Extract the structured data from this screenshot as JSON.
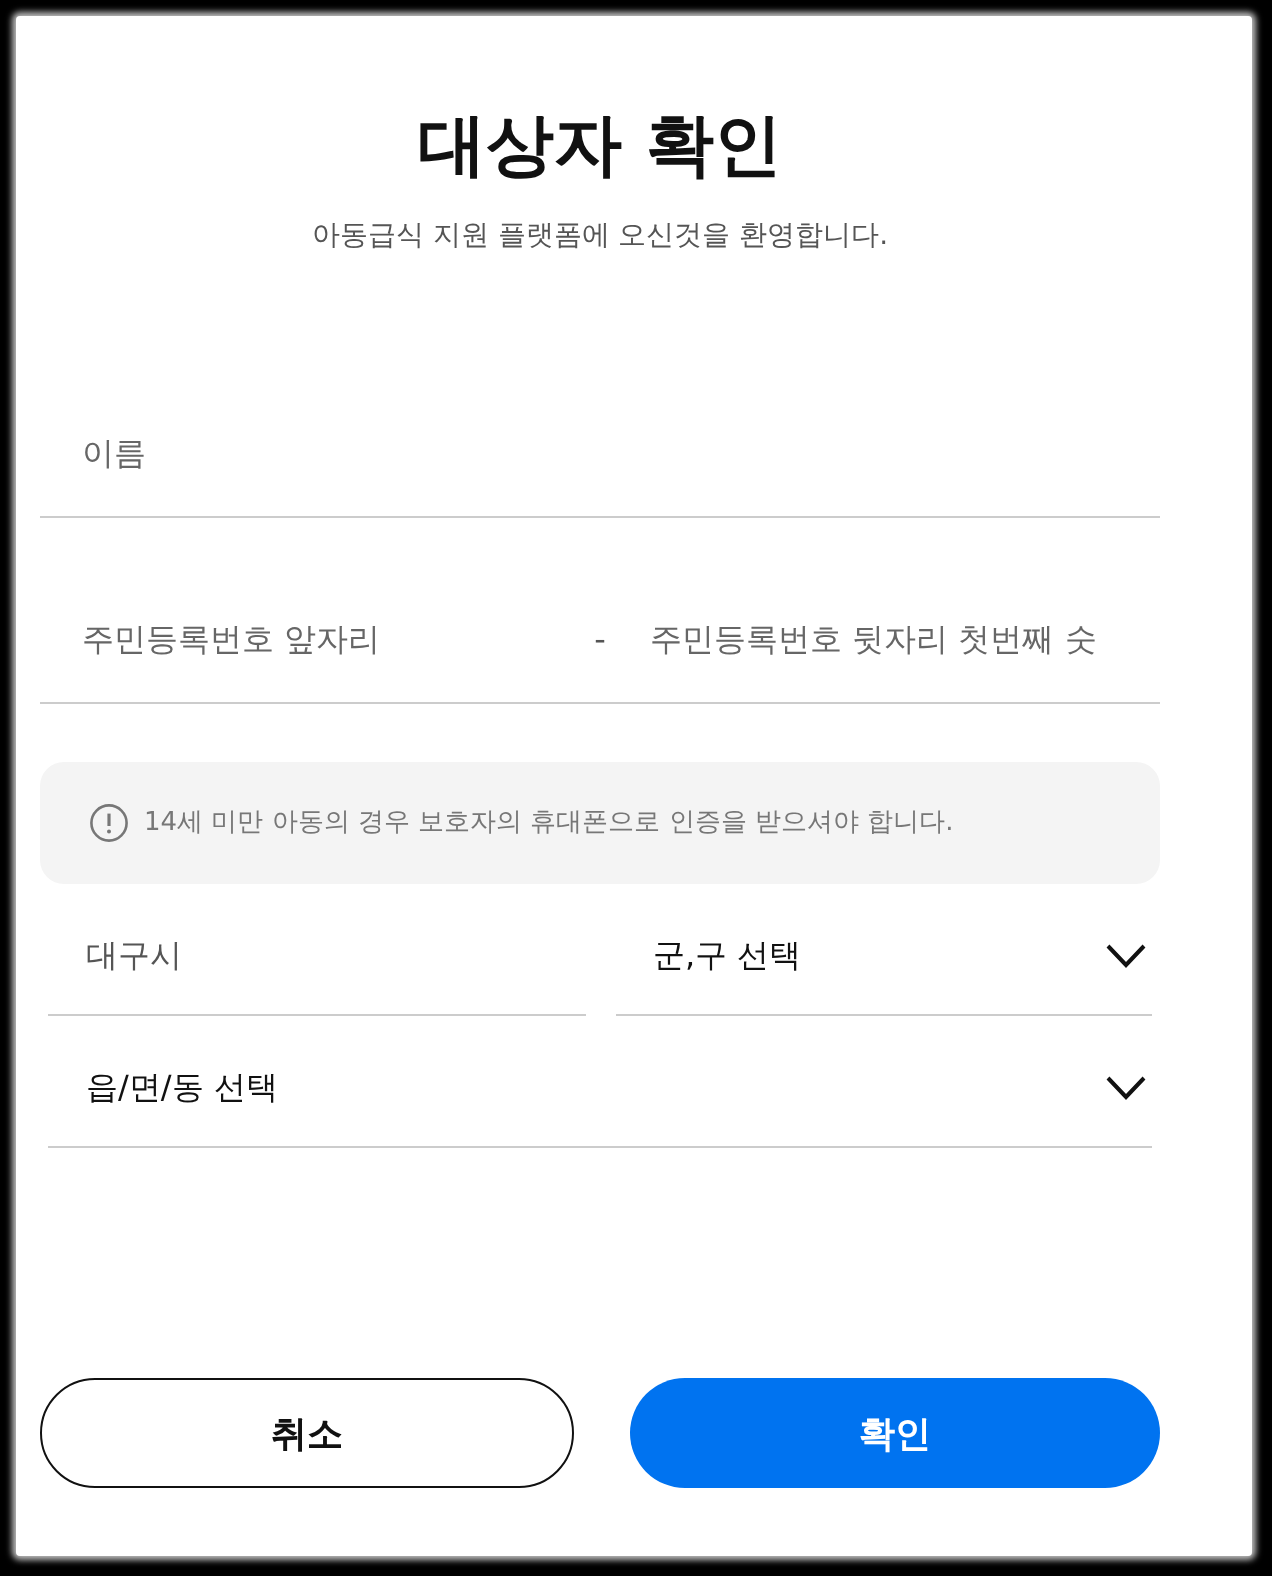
{
  "title": "대상자 확인",
  "subtitle": "아동급식 지원 플랫폼에 오신것을 환영합니다.",
  "name_field": {
    "placeholder": "이름"
  },
  "resident_number": {
    "front": {
      "placeholder": "주민등록번호 앞자리"
    },
    "separator": "-",
    "back": {
      "placeholder": "주민등록번호 뒷자리 첫번째 숫"
    }
  },
  "notice": {
    "text": "14세 미만 아동의 경우 보호자의 휴대폰으로 인증을 받으셔야 합니다."
  },
  "address": {
    "rows": [
      {
        "selects": [
          {
            "value": "대구시",
            "disabled": true
          },
          {
            "value": "군,구 선택",
            "disabled": false
          }
        ]
      },
      {
        "selects": [
          {
            "value": "읍/면/동 선택",
            "disabled": false
          }
        ]
      }
    ]
  },
  "buttons": [
    {
      "label": "취소",
      "kind": "secondary"
    },
    {
      "label": "확인",
      "kind": "primary"
    }
  ]
}
